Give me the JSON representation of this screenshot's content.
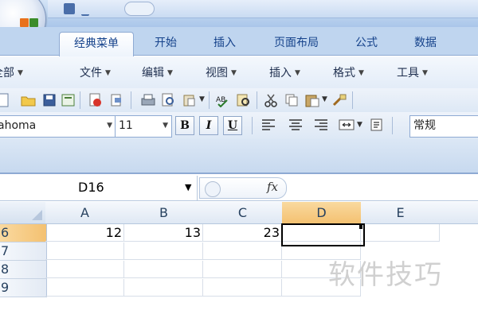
{
  "ribbon": {
    "tabs": [
      "经典菜单",
      "开始",
      "插入",
      "页面布局",
      "公式",
      "数据"
    ],
    "active_tab": "经典菜单"
  },
  "classic_menu": {
    "items": [
      "全部",
      "文件",
      "编辑",
      "视图",
      "插入",
      "格式",
      "工具"
    ],
    "partial_first": "全部"
  },
  "toolbar": {
    "icons": [
      "new-icon",
      "open-icon",
      "save-icon",
      "save-as-icon",
      "print-pdf-icon",
      "export-icon",
      "print-icon",
      "print-preview-icon",
      "paste-special-icon",
      "spellcheck-icon",
      "research-icon",
      "cut-icon",
      "copy-icon",
      "paste-icon",
      "format-painter-icon"
    ]
  },
  "format_bar": {
    "font_name": "Tahoma",
    "font_name_visible": "ahoma",
    "font_size": "11",
    "bold": "B",
    "italic": "I",
    "underline": "U",
    "number_format": "常规"
  },
  "formula_bar": {
    "name_box": "D16",
    "fx": "fx",
    "formula": ""
  },
  "grid": {
    "columns": [
      "A",
      "B",
      "C",
      "D",
      "E"
    ],
    "selected_column": "D",
    "rows": [
      {
        "label": "6",
        "cells": [
          "12",
          "13",
          "23",
          "",
          ""
        ]
      },
      {
        "label": "7",
        "cells": [
          "",
          "",
          "",
          "",
          ""
        ]
      },
      {
        "label": "8",
        "cells": [
          "",
          "",
          "",
          "",
          ""
        ]
      },
      {
        "label": "9",
        "cells": [
          "",
          "",
          "",
          "",
          ""
        ]
      }
    ],
    "selected_row": "6"
  },
  "watermark": "软件技巧",
  "colors": {
    "accent": "#15428b",
    "ribbon_bg": "#bfd5ef",
    "selected_header": "#f4c171"
  }
}
